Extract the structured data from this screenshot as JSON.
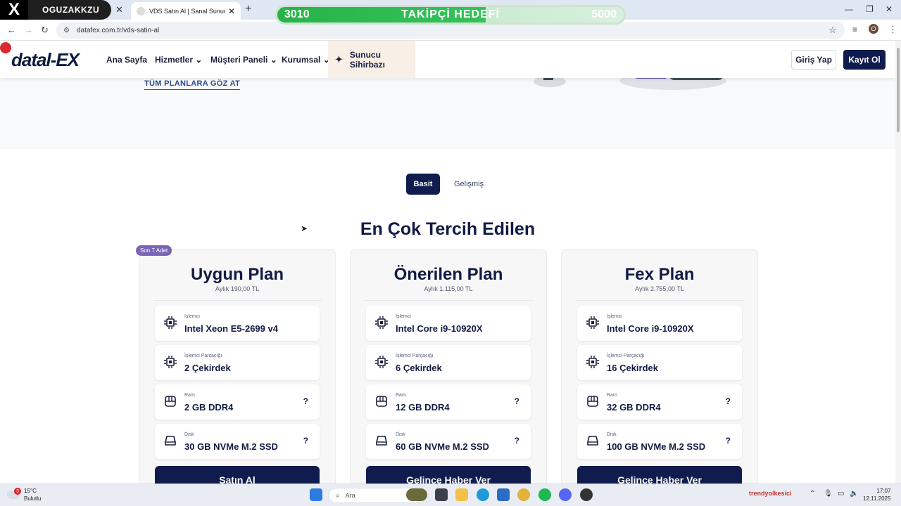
{
  "browser": {
    "x_logo": "X",
    "streamer_name": "OGUZAKKZU",
    "active_tab_title": "VDS Satın Al | Sanal Sunucu Kiral",
    "goal": {
      "current": "3010",
      "label": "TAKİPÇİ HEDEFİ",
      "target": "5000",
      "progress": 0.602
    },
    "url": "datafex.com.tr/vds-satin-al",
    "profile_initial": "O"
  },
  "navbar": {
    "brand": "datal-EX",
    "items": [
      {
        "label": "Ana Sayfa"
      },
      {
        "label": "Hizmetler"
      },
      {
        "label": "Müşteri Paneli"
      },
      {
        "label": "Kurumsal"
      }
    ],
    "wizard_label": "Sunucu Sihirbazı",
    "login_label": "Giriş Yap",
    "register_label": "Kayıt Ol"
  },
  "hero": {
    "all_plans_link": "TÜM PLANLARA GÖZ AT"
  },
  "toggle": {
    "basic": "Basit",
    "advanced": "Gelişmiş"
  },
  "section_title": "En Çok Tercih Edilen",
  "plans": [
    {
      "badge": "Son 7 Adet",
      "name": "Uygun Plan",
      "price": "Aylık 190,00 TL",
      "specs": [
        {
          "label": "İşlemci",
          "value": "Intel Xeon E5-2699 v4",
          "icon": "cpu-icon"
        },
        {
          "label": "İşlemci Parçacığı",
          "value": "2 Çekirdek",
          "icon": "cpu-icon"
        },
        {
          "label": "Ram",
          "value": "2 GB DDR4",
          "icon": "ram-icon",
          "help": "?"
        },
        {
          "label": "Disk",
          "value": "30 GB NVMe M.2 SSD",
          "icon": "disk-icon",
          "help": "?"
        }
      ],
      "cta": "Satın Al"
    },
    {
      "name": "Önerilen Plan",
      "price": "Aylık 1.115,00 TL",
      "specs": [
        {
          "label": "İşlemci",
          "value": "Intel Core i9-10920X",
          "icon": "cpu-icon"
        },
        {
          "label": "İşlemci Parçacığı",
          "value": "6 Çekirdek",
          "icon": "cpu-icon"
        },
        {
          "label": "Ram",
          "value": "12 GB DDR4",
          "icon": "ram-icon",
          "help": "?"
        },
        {
          "label": "Disk",
          "value": "60 GB NVMe M.2 SSD",
          "icon": "disk-icon",
          "help": "?"
        }
      ],
      "cta": "Gelince Haber Ver"
    },
    {
      "name": "Fex Plan",
      "price": "Aylık 2.755,00 TL",
      "specs": [
        {
          "label": "İşlemci",
          "value": "Intel Core i9-10920X",
          "icon": "cpu-icon"
        },
        {
          "label": "İşlemci Parçacığı",
          "value": "16 Çekirdek",
          "icon": "cpu-icon"
        },
        {
          "label": "Ram",
          "value": "32 GB DDR4",
          "icon": "ram-icon",
          "help": "?"
        },
        {
          "label": "Disk",
          "value": "100 GB NVMe M.2 SSD",
          "icon": "disk-icon",
          "help": "?"
        }
      ],
      "cta": "Gelince Haber Ver"
    }
  ],
  "taskbar": {
    "weather_temp": "15°C",
    "weather_desc": "Bulutlu",
    "weather_badge": "3",
    "search_placeholder": "Ara",
    "trendyol": "trendyolkesici",
    "time": "17:07",
    "date": "12.11.2025"
  },
  "colors": {
    "navy": "#0f1c4d",
    "badge_purple": "#7a64b5",
    "goal_green": "#27b34a"
  }
}
